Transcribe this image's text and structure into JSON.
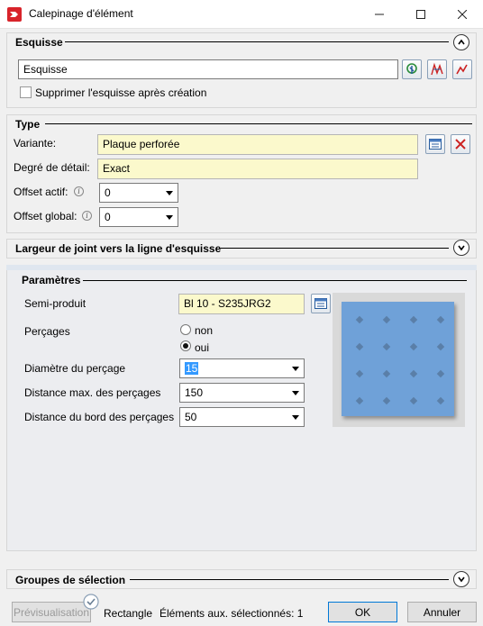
{
  "window": {
    "title": "Calepinage d'élément",
    "minimize_glyph": "—",
    "maximize_glyph": "☐",
    "close_glyph": "✕",
    "icon": "app-red-icon"
  },
  "esquisse": {
    "title": "Esquisse",
    "field_value": "Esquisse",
    "checkbox_label": "Supprimer l'esquisse après création",
    "checkbox_checked": false,
    "tool_icons": [
      "pick-sketch-icon",
      "sketch-lines-icon",
      "sketch-red-lines-icon"
    ]
  },
  "type": {
    "title": "Type",
    "variante_label": "Variante:",
    "variante_value": "Plaque perforée",
    "degre_label": "Degré de détail:",
    "degre_value": "Exact",
    "offset_actif_label": "Offset actif:",
    "offset_actif_value": "0",
    "offset_global_label": "Offset global:",
    "offset_global_value": "0"
  },
  "largeur": {
    "title": "Largeur de joint vers la ligne d'esquisse"
  },
  "parametres": {
    "title": "Paramètres",
    "semi_produit_label": "Semi-produit",
    "semi_produit_value": "Bl 10 - S235JRG2",
    "percages_label": "Perçages",
    "radio_non": "non",
    "radio_oui": "oui",
    "radio_selected": "oui",
    "diametre_label": "Diamètre du perçage",
    "diametre_value": "15",
    "distance_max_label": "Distance max. des perçages",
    "distance_max_value": "150",
    "distance_bord_label": "Distance du bord des perçages",
    "distance_bord_value": "50"
  },
  "groupes": {
    "title": "Groupes de sélection"
  },
  "footer": {
    "preview_button": "Prévisualisation",
    "mode_text": "Rectangle",
    "status_text": "Éléments aux. sélectionnés: 1",
    "ok_button": "OK",
    "cancel_button": "Annuler"
  },
  "colors": {
    "plate_blue": "#6fa1d8",
    "field_yellow": "#fbf9cc",
    "accent": "#0078d7"
  }
}
